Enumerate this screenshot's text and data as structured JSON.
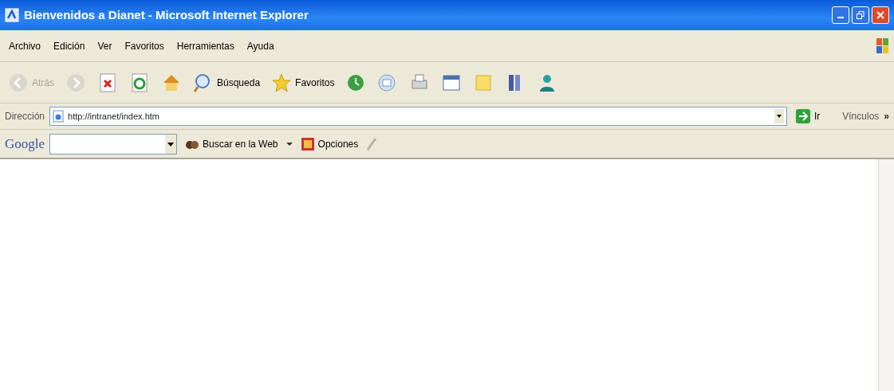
{
  "window": {
    "title": "Bienvenidos a Dianet - Microsoft Internet Explorer"
  },
  "menu": [
    "Archivo",
    "Edición",
    "Ver",
    "Favoritos",
    "Herramientas",
    "Ayuda"
  ],
  "toolbar": [
    {
      "kind": "back",
      "label": "Atrás",
      "disabled": true
    },
    {
      "kind": "forward",
      "disabled": true
    },
    {
      "kind": "stop"
    },
    {
      "kind": "refresh"
    },
    {
      "kind": "home"
    },
    {
      "kind": "search",
      "label": "Búsqueda"
    },
    {
      "kind": "favorites",
      "label": "Favoritos"
    },
    {
      "kind": "history"
    },
    {
      "kind": "mail"
    },
    {
      "kind": "print"
    },
    {
      "kind": "edit"
    },
    {
      "kind": "folder"
    },
    {
      "kind": "research"
    },
    {
      "kind": "messenger"
    }
  ],
  "address": {
    "label": "Dirección",
    "value": "http://intranet/index.htm",
    "go": "Ir",
    "links": "Vínculos",
    "more": "»"
  },
  "google_bar": {
    "logo": "Google",
    "search_button": "Buscar en la Web",
    "options": "Opciones"
  }
}
